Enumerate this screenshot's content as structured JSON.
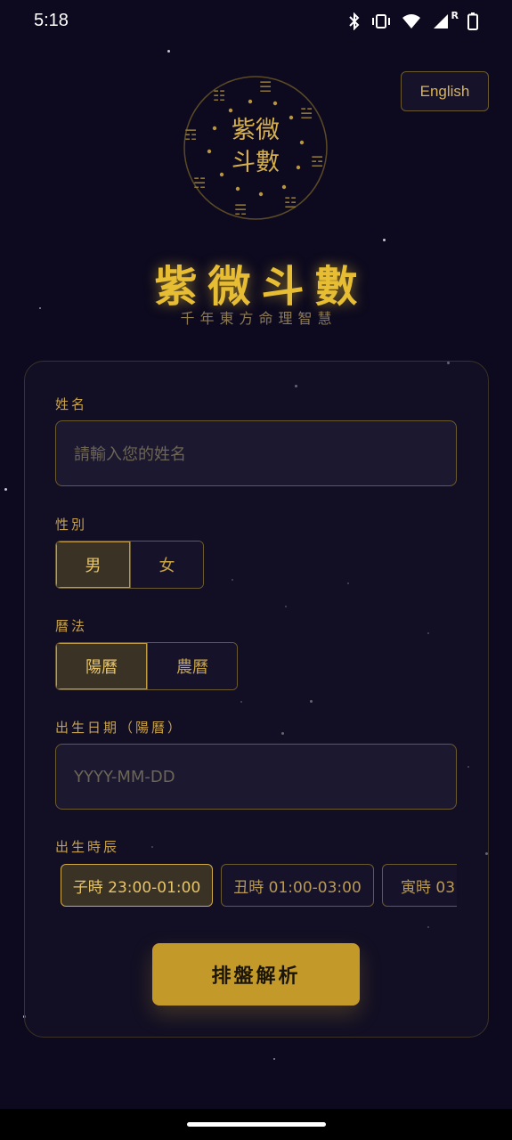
{
  "status_bar": {
    "time": "5:18",
    "icons": [
      "bluetooth-icon",
      "vibrate-icon",
      "wifi-icon",
      "signal-icon",
      "battery-icon"
    ],
    "roaming_label": "R"
  },
  "language_button": {
    "label": "English"
  },
  "logo": {
    "line1": "紫微",
    "line2": "斗數",
    "trigram_glyphs": [
      "☰",
      "☱",
      "☲",
      "☳",
      "☴",
      "☵",
      "☶",
      "☷"
    ]
  },
  "app": {
    "title": "紫微斗數",
    "subtitle": "千年東方命理智慧"
  },
  "form": {
    "name": {
      "label": "姓名",
      "placeholder": "請輸入您的姓名",
      "value": ""
    },
    "gender": {
      "label": "性別",
      "options": [
        "男",
        "女"
      ],
      "selected": "男"
    },
    "calendar": {
      "label": "曆法",
      "options": [
        "陽曆",
        "農曆"
      ],
      "selected": "陽曆"
    },
    "birth_date": {
      "label": "出生日期（陽曆）",
      "placeholder": "YYYY-MM-DD",
      "value": ""
    },
    "birth_hour": {
      "label": "出生時辰",
      "options": [
        "子時 23:00-01:00",
        "丑時 01:00-03:00",
        "寅時 03:"
      ],
      "selected": "子時 23:00-01:00"
    },
    "submit_label": "排盤解析"
  },
  "colors": {
    "background": "#0d0a1f",
    "accent_gold": "#e7bd33",
    "button_gold": "#c39a2a",
    "border_gold": "#6b5a2e"
  }
}
